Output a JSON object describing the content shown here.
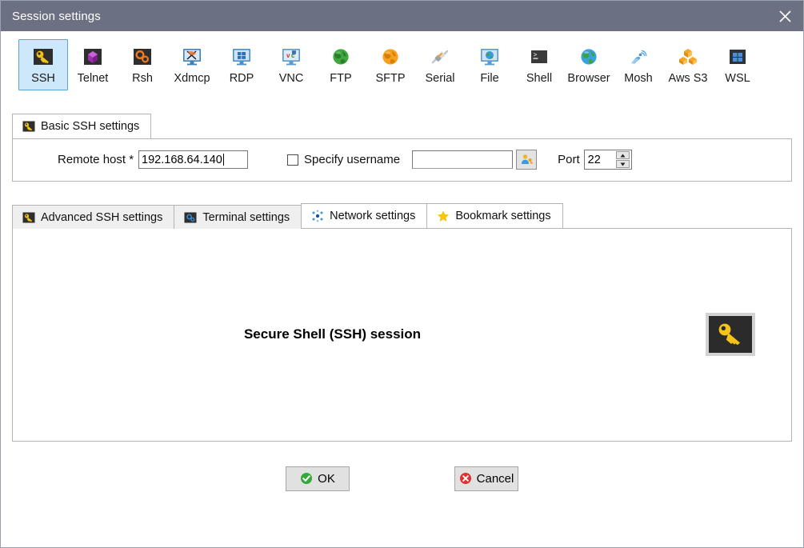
{
  "window": {
    "title": "Session settings",
    "close_label": "close-window",
    "titlebar_color": "#6b7183"
  },
  "protocols": [
    {
      "label": "SSH",
      "icon": "key-icon",
      "selected": true
    },
    {
      "label": "Telnet",
      "icon": "telnet-cube-icon",
      "selected": false
    },
    {
      "label": "Rsh",
      "icon": "gears-icon",
      "selected": false
    },
    {
      "label": "Xdmcp",
      "icon": "x-monitor-icon",
      "selected": false
    },
    {
      "label": "RDP",
      "icon": "windows-monitor-icon",
      "selected": false
    },
    {
      "label": "VNC",
      "icon": "vnc-monitor-icon",
      "selected": false
    },
    {
      "label": "FTP",
      "icon": "green-globe-icon",
      "selected": false
    },
    {
      "label": "SFTP",
      "icon": "orange-globe-icon",
      "selected": false
    },
    {
      "label": "Serial",
      "icon": "plug-icon",
      "selected": false
    },
    {
      "label": "File",
      "icon": "globe-monitor-icon",
      "selected": false
    },
    {
      "label": "Shell",
      "icon": "terminal-icon",
      "selected": false
    },
    {
      "label": "Browser",
      "icon": "blue-globe-icon",
      "selected": false
    },
    {
      "label": "Mosh",
      "icon": "satellite-dish-icon",
      "selected": false
    },
    {
      "label": "Aws S3",
      "icon": "aws-cubes-icon",
      "selected": false
    },
    {
      "label": "WSL",
      "icon": "wsl-windows-icon",
      "selected": false
    }
  ],
  "basic_tab": {
    "label": "Basic SSH settings",
    "icon": "key-icon"
  },
  "form": {
    "remote_host_label": "Remote host *",
    "remote_host_value": "192.168.64.140",
    "specify_username_label": "Specify username",
    "specify_username_checked": false,
    "username_value": "",
    "username_placeholder": "",
    "user_browse_icon": "user-key-icon",
    "port_label": "Port",
    "port_value": "22",
    "spin_up_icon": "spin-up-icon",
    "spin_down_icon": "spin-down-icon"
  },
  "settings_tabs": [
    {
      "label": "Advanced SSH settings",
      "icon": "key-icon",
      "active": false
    },
    {
      "label": "Terminal settings",
      "icon": "gear-icon",
      "active": false
    },
    {
      "label": "Network settings",
      "icon": "network-icon",
      "active": true
    },
    {
      "label": "Bookmark settings",
      "icon": "star-icon",
      "active": true
    }
  ],
  "content": {
    "session_text": "Secure Shell (SSH) session",
    "session_icon": "key-icon"
  },
  "buttons": {
    "ok_label": "OK",
    "ok_icon": "check-circle-icon",
    "cancel_label": "Cancel",
    "cancel_icon": "x-circle-icon"
  }
}
